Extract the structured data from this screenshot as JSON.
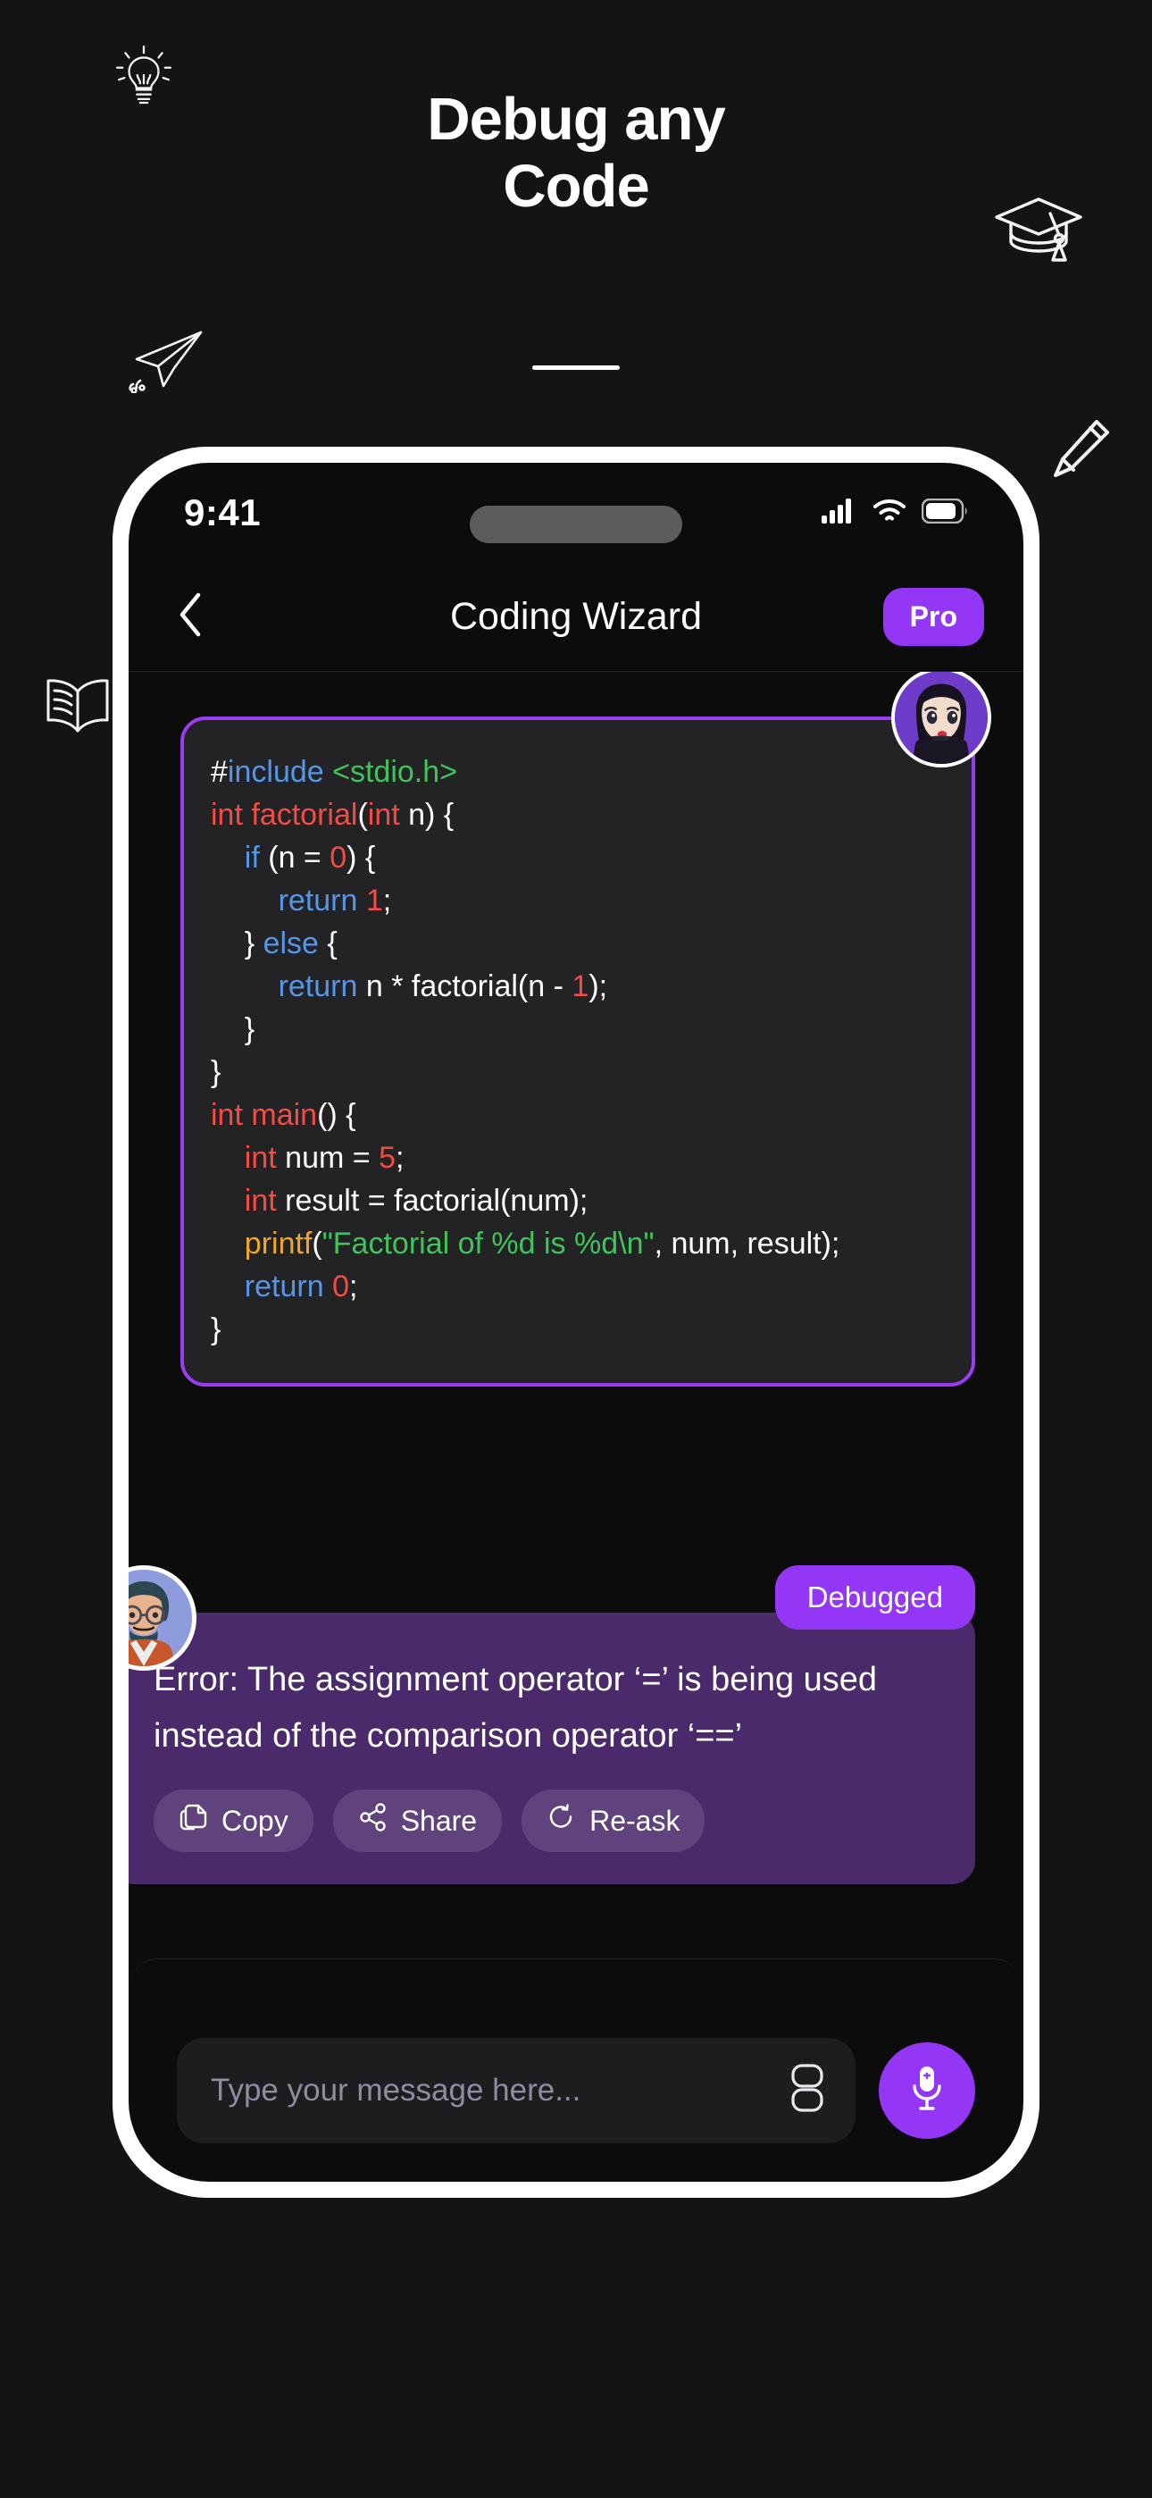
{
  "promo": {
    "title_line1": "Debug any",
    "title_line2": "Code",
    "doodles": [
      "lightbulb-icon",
      "graduation-cap-icon",
      "paper-plane-icon",
      "pencil-icon",
      "open-book-icon"
    ]
  },
  "status_bar": {
    "time": "9:41",
    "icons": [
      "cellular-signal-icon",
      "wifi-icon",
      "battery-icon"
    ]
  },
  "header": {
    "back_icon": "chevron-left-icon",
    "title": "Coding Wizard",
    "pro_label": "Pro"
  },
  "code_block": {
    "border_color": "#9B3BF2",
    "background": "#232326",
    "lines": [
      [
        {
          "t": "#",
          "c": "plain"
        },
        {
          "t": "include",
          "c": "key"
        },
        {
          "t": " ",
          "c": "plain"
        },
        {
          "t": "<stdio.h>",
          "c": "str"
        }
      ],
      [
        {
          "t": "int",
          "c": "type"
        },
        {
          "t": " ",
          "c": "plain"
        },
        {
          "t": "factorial",
          "c": "type"
        },
        {
          "t": "(",
          "c": "plain"
        },
        {
          "t": "int",
          "c": "type"
        },
        {
          "t": " n) {",
          "c": "plain"
        }
      ],
      [
        {
          "t": "    ",
          "c": "plain"
        },
        {
          "t": "if",
          "c": "key"
        },
        {
          "t": " (n = ",
          "c": "plain"
        },
        {
          "t": "0",
          "c": "num"
        },
        {
          "t": ") {",
          "c": "plain"
        }
      ],
      [
        {
          "t": "        ",
          "c": "plain"
        },
        {
          "t": "return",
          "c": "key"
        },
        {
          "t": " ",
          "c": "plain"
        },
        {
          "t": "1",
          "c": "num"
        },
        {
          "t": ";",
          "c": "plain"
        }
      ],
      [
        {
          "t": "    } ",
          "c": "plain"
        },
        {
          "t": "else",
          "c": "key"
        },
        {
          "t": " {",
          "c": "plain"
        }
      ],
      [
        {
          "t": "        ",
          "c": "plain"
        },
        {
          "t": "return",
          "c": "key"
        },
        {
          "t": " n * factorial(n - ",
          "c": "plain"
        },
        {
          "t": "1",
          "c": "num"
        },
        {
          "t": ");",
          "c": "plain"
        }
      ],
      [
        {
          "t": "    }",
          "c": "plain"
        }
      ],
      [
        {
          "t": "}",
          "c": "plain"
        }
      ],
      [
        {
          "t": "int",
          "c": "type"
        },
        {
          "t": " ",
          "c": "plain"
        },
        {
          "t": "main",
          "c": "type"
        },
        {
          "t": "() {",
          "c": "plain"
        }
      ],
      [
        {
          "t": "    ",
          "c": "plain"
        },
        {
          "t": "int",
          "c": "type"
        },
        {
          "t": " num = ",
          "c": "plain"
        },
        {
          "t": "5",
          "c": "num"
        },
        {
          "t": ";",
          "c": "plain"
        }
      ],
      [
        {
          "t": "    ",
          "c": "plain"
        },
        {
          "t": "int",
          "c": "type"
        },
        {
          "t": " result = factorial(num);",
          "c": "plain"
        }
      ],
      [
        {
          "t": "    ",
          "c": "plain"
        },
        {
          "t": "printf",
          "c": "fn"
        },
        {
          "t": "(",
          "c": "plain"
        },
        {
          "t": "\"Factorial of %d is %d\\n\"",
          "c": "str"
        },
        {
          "t": ", num, result);",
          "c": "plain"
        }
      ],
      [
        {
          "t": "    ",
          "c": "plain"
        },
        {
          "t": "return",
          "c": "key"
        },
        {
          "t": " ",
          "c": "plain"
        },
        {
          "t": "0",
          "c": "num"
        },
        {
          "t": ";",
          "c": "plain"
        }
      ],
      [
        {
          "t": "}",
          "c": "plain"
        }
      ]
    ]
  },
  "answer": {
    "badge_label": "Debugged",
    "text": "Error: The assignment operator ‘=’ is being used instead of the comparison operator ‘==’",
    "actions": [
      {
        "label": "Copy",
        "icon": "copy-icon"
      },
      {
        "label": "Share",
        "icon": "share-icon"
      },
      {
        "label": "Re-ask",
        "icon": "refresh-icon"
      }
    ]
  },
  "composer": {
    "placeholder": "Type your message here...",
    "attach_icon": "code-block-icon",
    "mic_icon": "microphone-icon"
  },
  "colors": {
    "accent_purple": "#9436F5",
    "bubble_purple": "#4A2A6A",
    "page_bg": "#141414"
  }
}
